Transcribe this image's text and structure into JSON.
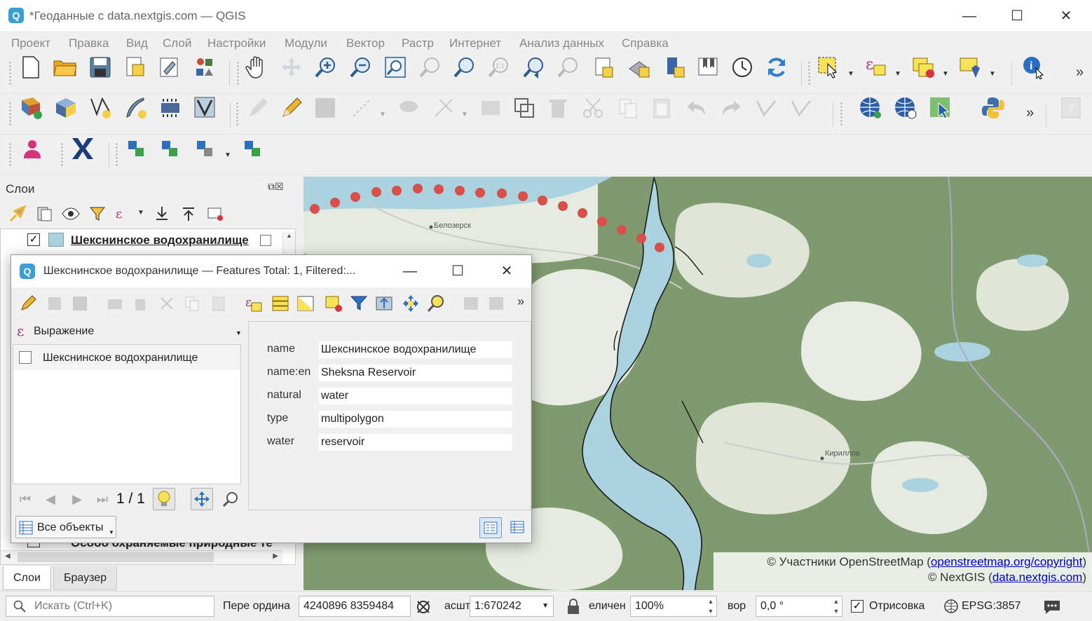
{
  "window": {
    "title": "*Геоданные с data.nextgis.com — QGIS",
    "min_glyph": "—",
    "max_glyph": "☐",
    "close_glyph": "✕"
  },
  "menu": [
    "Проект",
    "Правка",
    "Вид",
    "Слой",
    "Настройки",
    "Модули",
    "Вектор",
    "Растр",
    "Интернет",
    "Анализ данных",
    "Справка"
  ],
  "toolbar_icons": {
    "row1": [
      "new-project-icon",
      "open-project-icon",
      "save-project-icon",
      "project-templates-icon",
      "layout-designer-icon",
      "style-manager-icon",
      "pan-icon",
      "pan-to-selection-icon",
      "zoom-in-icon",
      "zoom-out-icon",
      "zoom-full-icon",
      "zoom-selection-icon",
      "zoom-layer-icon",
      "zoom-native-icon",
      "zoom-last-icon",
      "zoom-next-icon",
      "new-bookmark-icon",
      "new-3d-view-icon",
      "new-map-view-icon",
      "show-bookmarks-icon",
      "temporal-controller-icon",
      "refresh-icon",
      "select-features-icon",
      "select-expression-icon",
      "deselect-icon",
      "select-tools-icon",
      "identify-icon"
    ],
    "row2": [
      "data-source-manager-icon",
      "new-geopackage-icon",
      "new-shapefile-icon",
      "new-spatialite-icon",
      "new-temp-layer-icon",
      "new-virtual-layer-icon",
      "toggle-editing-icon",
      "current-edits-icon",
      "save-edits-icon",
      "digitize-icon",
      "vertex-tool-icon",
      "modify-attributes-icon",
      "copy-features-icon",
      "delete-selected-icon",
      "cut-icon",
      "copy-icon",
      "paste-icon",
      "undo-icon",
      "redo-icon",
      "digitize-with-segment-icon",
      "shape-icon",
      "wms-icon",
      "wfs-icon",
      "gps-icon",
      "python-console-icon",
      "help-icon"
    ],
    "row3": [
      "user-icon",
      "nextgis-x-icon",
      "add-feature-icon",
      "add-part-icon",
      "add-ring-icon",
      "add-vertex-icon"
    ]
  },
  "layers_panel": {
    "title": "Слои",
    "tree_item_1": "Шекснинское водохранилище",
    "tree_item_1_checked": "✓",
    "tree_item_bottom": "Особо охраняемые природные те",
    "tree_item_bottom_checked": "✓",
    "tabs": [
      "Слои",
      "Браузер"
    ]
  },
  "map": {
    "labels": {
      "town1": "Белозерск",
      "town2": "Кириллов"
    },
    "water_color": "#aad3df",
    "forest_color": "#7f9a6e",
    "field_color": "#e9ece5",
    "route_color": "#d9504a",
    "attribution_line1_prefix": "© Участники OpenStreetMap (",
    "attribution_line1_link": "openstreetmap.org/copyright",
    "attribution_line1_suffix": ")",
    "attribution_line2_prefix": "© NextGIS (",
    "attribution_line2_link": "data.nextgis.com",
    "attribution_line2_suffix": ")"
  },
  "dialog": {
    "title": "Шекснинское водохранилище — Features Total: 1, Filtered:...",
    "expression_label": "Выражение",
    "feature_list_item": "Шекснинское водохранилище",
    "navigation": "1 / 1",
    "show_all_label": "Все объекты",
    "fields": [
      {
        "label": "name",
        "value": "Шекснинское водохранилище"
      },
      {
        "label": "name:en",
        "value": "Sheksna Reservoir"
      },
      {
        "label": "natural",
        "value": "water"
      },
      {
        "label": "type",
        "value": "multipolygon"
      },
      {
        "label": "water",
        "value": "reservoir"
      }
    ]
  },
  "status": {
    "search_placeholder": "Искать (Ctrl+K)",
    "coord_label": "Пере  ордина",
    "coord_value": "4240896  8359484",
    "scale_label": "асшт",
    "scale_value": "1:670242",
    "magnifier_label": "еличен",
    "magnifier_value": "100%",
    "rotation_label": "вор",
    "rotation_value": "0,0 °",
    "render_label": "Отрисовка",
    "render_checked": "✓",
    "crs": "EPSG:3857"
  }
}
